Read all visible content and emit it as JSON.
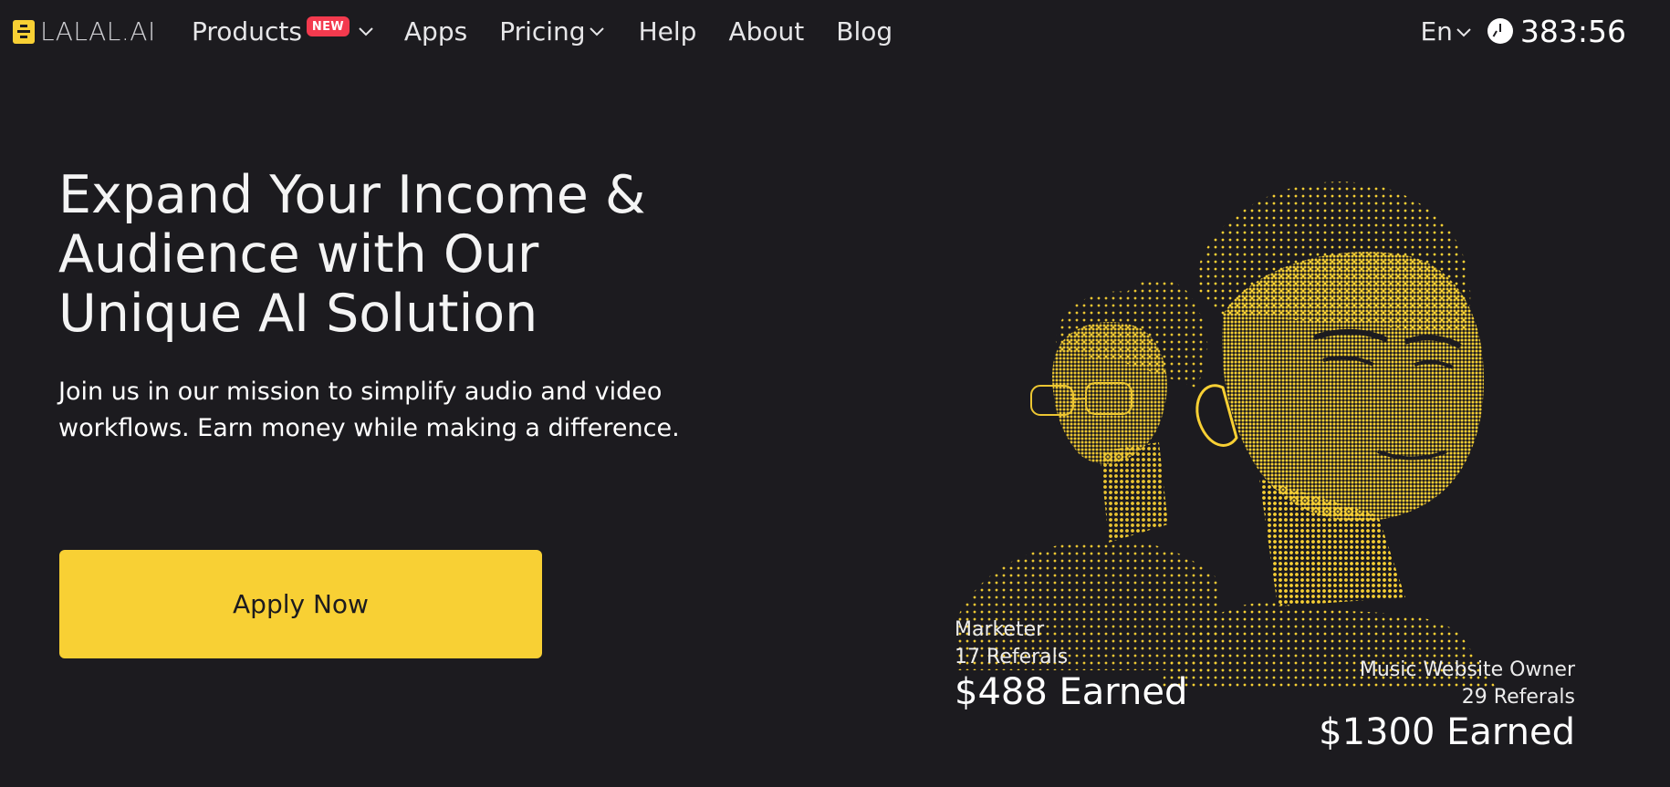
{
  "nav": {
    "logo_text": "LALAL.AI",
    "items": [
      {
        "label": "Products",
        "badge": "NEW",
        "has_dropdown": true
      },
      {
        "label": "Apps"
      },
      {
        "label": "Pricing",
        "has_dropdown": true
      },
      {
        "label": "Help"
      },
      {
        "label": "About"
      },
      {
        "label": "Blog"
      }
    ],
    "language": "En",
    "timer": "383:56"
  },
  "hero": {
    "title": "Expand Your Income & Audience with Our Unique AI Solution",
    "subtitle": "Join us in our mission to simplify audio and video workflows. Earn money while making a difference.",
    "cta_label": "Apply Now"
  },
  "stats": [
    {
      "role": "Marketer",
      "referrals": "17 Referals",
      "earned": "$488 Earned"
    },
    {
      "role": "Music Website Owner",
      "referrals": "29 Referals",
      "earned": "$1300 Earned"
    }
  ],
  "colors": {
    "background": "#1c1b1f",
    "accent": "#f8d034",
    "badge": "#f33a4e",
    "text": "#ffffff"
  }
}
